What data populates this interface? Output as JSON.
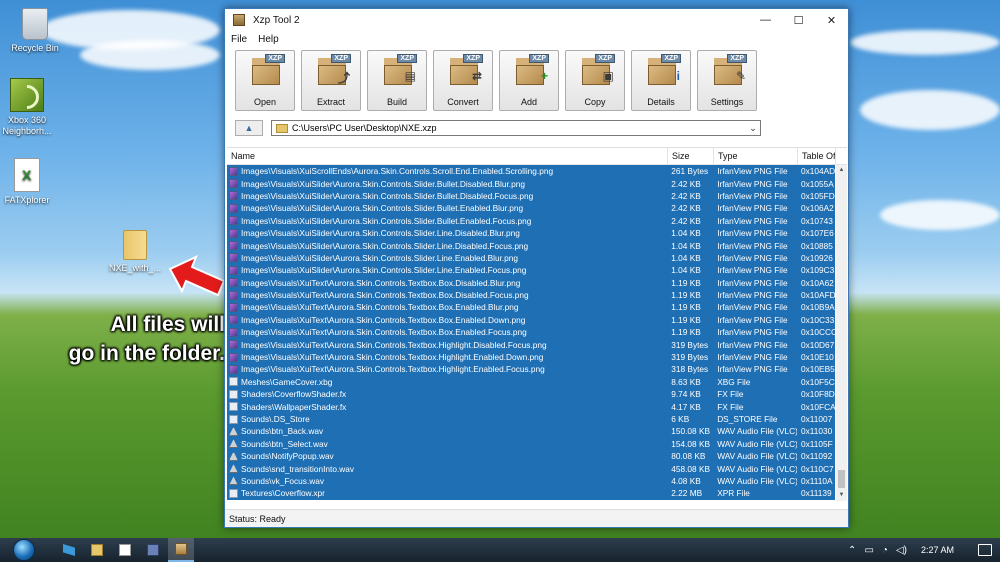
{
  "desktop": {
    "icons": [
      {
        "label": "Recycle Bin"
      },
      {
        "label": "Xbox 360 Neighborh..."
      },
      {
        "label": "FATXplorer"
      },
      {
        "label": "NXE_with_..."
      }
    ],
    "callout": [
      "All files will",
      "go in the folder."
    ]
  },
  "window": {
    "title": "Xzp Tool 2",
    "controls": {
      "minimize": "—",
      "maximize": "☐",
      "close": "✕"
    },
    "menu": [
      "File",
      "Help"
    ],
    "toolbar": [
      {
        "label": "Open",
        "icon": "open-icon"
      },
      {
        "label": "Extract",
        "icon": "extract-icon"
      },
      {
        "label": "Build",
        "icon": "build-icon"
      },
      {
        "label": "Convert",
        "icon": "convert-icon"
      },
      {
        "label": "Add",
        "icon": "add-icon"
      },
      {
        "label": "Copy",
        "icon": "copy-icon"
      },
      {
        "label": "Details",
        "icon": "details-icon"
      },
      {
        "label": "Settings",
        "icon": "settings-icon"
      }
    ],
    "badge": "XZP",
    "path": "C:\\Users\\PC User\\Desktop\\NXE.xzp",
    "columns": [
      "Name",
      "Size",
      "Type",
      "Table Offs"
    ],
    "files": [
      {
        "name": "Images\\Visuals\\XuiScrollEnds\\Aurora.Skin.Controls.Scroll.End.Enabled.Scrolling.png",
        "size": "261 Bytes",
        "type": "IrfanView PNG File",
        "offset": "0x104AD",
        "icon": "png"
      },
      {
        "name": "Images\\Visuals\\XuiSlider\\Aurora.Skin.Controls.Slider.Bullet.Disabled.Blur.png",
        "size": "2.42 KB",
        "type": "IrfanView PNG File",
        "offset": "0x1055A",
        "icon": "png"
      },
      {
        "name": "Images\\Visuals\\XuiSlider\\Aurora.Skin.Controls.Slider.Bullet.Disabled.Focus.png",
        "size": "2.42 KB",
        "type": "IrfanView PNG File",
        "offset": "0x105FD",
        "icon": "png"
      },
      {
        "name": "Images\\Visuals\\XuiSlider\\Aurora.Skin.Controls.Slider.Bullet.Enabled.Blur.png",
        "size": "2.42 KB",
        "type": "IrfanView PNG File",
        "offset": "0x106A2",
        "icon": "png"
      },
      {
        "name": "Images\\Visuals\\XuiSlider\\Aurora.Skin.Controls.Slider.Bullet.Enabled.Focus.png",
        "size": "2.42 KB",
        "type": "IrfanView PNG File",
        "offset": "0x10743",
        "icon": "png"
      },
      {
        "name": "Images\\Visuals\\XuiSlider\\Aurora.Skin.Controls.Slider.Line.Disabled.Blur.png",
        "size": "1.04 KB",
        "type": "IrfanView PNG File",
        "offset": "0x107E6",
        "icon": "png"
      },
      {
        "name": "Images\\Visuals\\XuiSlider\\Aurora.Skin.Controls.Slider.Line.Disabled.Focus.png",
        "size": "1.04 KB",
        "type": "IrfanView PNG File",
        "offset": "0x10885",
        "icon": "png"
      },
      {
        "name": "Images\\Visuals\\XuiSlider\\Aurora.Skin.Controls.Slider.Line.Enabled.Blur.png",
        "size": "1.04 KB",
        "type": "IrfanView PNG File",
        "offset": "0x10926",
        "icon": "png"
      },
      {
        "name": "Images\\Visuals\\XuiSlider\\Aurora.Skin.Controls.Slider.Line.Enabled.Focus.png",
        "size": "1.04 KB",
        "type": "IrfanView PNG File",
        "offset": "0x109C3",
        "icon": "png"
      },
      {
        "name": "Images\\Visuals\\XuiText\\Aurora.Skin.Controls.Textbox.Box.Disabled.Blur.png",
        "size": "1.19 KB",
        "type": "IrfanView PNG File",
        "offset": "0x10A62",
        "icon": "png"
      },
      {
        "name": "Images\\Visuals\\XuiText\\Aurora.Skin.Controls.Textbox.Box.Disabled.Focus.png",
        "size": "1.19 KB",
        "type": "IrfanView PNG File",
        "offset": "0x10AFD",
        "icon": "png"
      },
      {
        "name": "Images\\Visuals\\XuiText\\Aurora.Skin.Controls.Textbox.Box.Enabled.Blur.png",
        "size": "1.19 KB",
        "type": "IrfanView PNG File",
        "offset": "0x10B9A",
        "icon": "png"
      },
      {
        "name": "Images\\Visuals\\XuiText\\Aurora.Skin.Controls.Textbox.Box.Enabled.Down.png",
        "size": "1.19 KB",
        "type": "IrfanView PNG File",
        "offset": "0x10C33",
        "icon": "png"
      },
      {
        "name": "Images\\Visuals\\XuiText\\Aurora.Skin.Controls.Textbox.Box.Enabled.Focus.png",
        "size": "1.19 KB",
        "type": "IrfanView PNG File",
        "offset": "0x10CCC",
        "icon": "png"
      },
      {
        "name": "Images\\Visuals\\XuiText\\Aurora.Skin.Controls.Textbox.Highlight.Disabled.Focus.png",
        "size": "319 Bytes",
        "type": "IrfanView PNG File",
        "offset": "0x10D67",
        "icon": "png"
      },
      {
        "name": "Images\\Visuals\\XuiText\\Aurora.Skin.Controls.Textbox.Highlight.Enabled.Down.png",
        "size": "319 Bytes",
        "type": "IrfanView PNG File",
        "offset": "0x10E10",
        "icon": "png"
      },
      {
        "name": "Images\\Visuals\\XuiText\\Aurora.Skin.Controls.Textbox.Highlight.Enabled.Focus.png",
        "size": "318 Bytes",
        "type": "IrfanView PNG File",
        "offset": "0x10EB5",
        "icon": "png"
      },
      {
        "name": "Meshes\\GameCover.xbg",
        "size": "8.63 KB",
        "type": "XBG File",
        "offset": "0x10F5C",
        "icon": "file"
      },
      {
        "name": "Shaders\\CoverflowShader.fx",
        "size": "9.74 KB",
        "type": "FX File",
        "offset": "0x10F8D",
        "icon": "file"
      },
      {
        "name": "Shaders\\WallpaperShader.fx",
        "size": "4.17 KB",
        "type": "FX File",
        "offset": "0x10FCA",
        "icon": "file"
      },
      {
        "name": "Sounds\\.DS_Store",
        "size": "6 KB",
        "type": "DS_STORE File",
        "offset": "0x11007",
        "icon": "file"
      },
      {
        "name": "Sounds\\btn_Back.wav",
        "size": "150.08 KB",
        "type": "WAV Audio File (VLC)",
        "offset": "0x11030",
        "icon": "wav"
      },
      {
        "name": "Sounds\\btn_Select.wav",
        "size": "154.08 KB",
        "type": "WAV Audio File (VLC)",
        "offset": "0x1105F",
        "icon": "wav"
      },
      {
        "name": "Sounds\\NotifyPopup.wav",
        "size": "80.08 KB",
        "type": "WAV Audio File (VLC)",
        "offset": "0x11092",
        "icon": "wav"
      },
      {
        "name": "Sounds\\snd_transitionInto.wav",
        "size": "458.08 KB",
        "type": "WAV Audio File (VLC)",
        "offset": "0x110C7",
        "icon": "wav"
      },
      {
        "name": "Sounds\\vk_Focus.wav",
        "size": "4.08 KB",
        "type": "WAV Audio File (VLC)",
        "offset": "0x1110A",
        "icon": "wav"
      },
      {
        "name": "Textures\\Coverflow.xpr",
        "size": "2.22 MB",
        "type": "XPR File",
        "offset": "0x11139",
        "icon": "file"
      }
    ],
    "status": "Status: Ready"
  },
  "taskbar": {
    "clock": "2:27 AM",
    "tray_icons": [
      "chevron-up-icon",
      "battery-icon",
      "wifi-icon",
      "volume-icon"
    ]
  },
  "colors": {
    "selection": "#1f6fb4",
    "accent": "#3a78b5"
  }
}
